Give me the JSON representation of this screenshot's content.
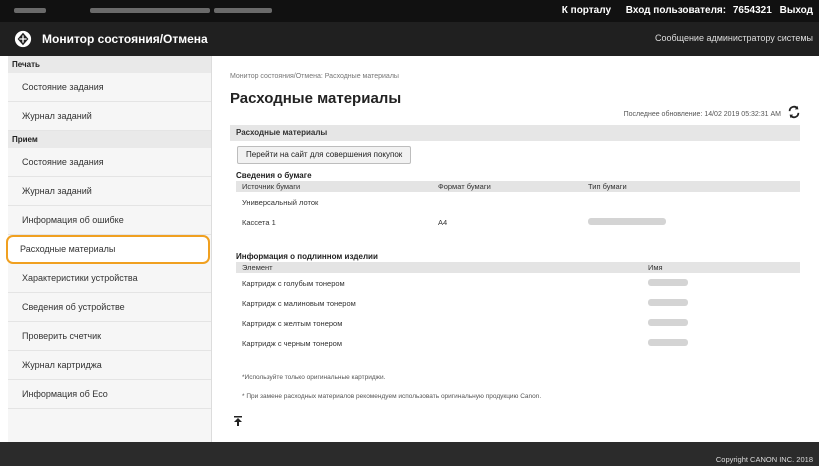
{
  "header": {
    "portal_link": "К порталу",
    "login_label": "Вход пользователя:",
    "login_user": "7654321",
    "logout_label": "Выход"
  },
  "titlebar": {
    "app_title": "Монитор состояния/Отмена",
    "admin_message": "Сообщение администратору системы"
  },
  "sidebar": {
    "print_header": "Печать",
    "print_items": [
      {
        "label": "Состояние задания"
      },
      {
        "label": "Журнал заданий"
      }
    ],
    "receive_header": "Прием",
    "receive_items": [
      {
        "label": "Состояние задания"
      },
      {
        "label": "Журнал заданий"
      },
      {
        "label": "Информация об ошибке"
      },
      {
        "label": "Расходные материалы"
      },
      {
        "label": "Характеристики устройства"
      },
      {
        "label": "Сведения об устройстве"
      },
      {
        "label": "Проверить счетчик"
      },
      {
        "label": "Журнал картриджа"
      },
      {
        "label": "Информация об Eco"
      }
    ]
  },
  "main": {
    "breadcrumb": "Монитор состояния/Отмена: Расходные материалы",
    "title": "Расходные материалы",
    "last_update_label": "Последнее обновление:",
    "last_update_value": "14/02 2019 05:32:31 AM",
    "panel_header": "Расходные материалы",
    "buy_button": "Перейти на сайт для совершения покупок",
    "paper": {
      "title": "Сведения о бумаге",
      "headers": [
        "Источник бумаги",
        "Формат бумаги",
        "Тип бумаги"
      ],
      "rows": [
        {
          "source": "Универсальный лоток",
          "size": "",
          "type": ""
        },
        {
          "source": "Кассета 1",
          "size": "A4",
          "type": ""
        }
      ]
    },
    "parts": {
      "title": "Информация о подлинном изделии",
      "headers": [
        "Элемент",
        "Имя"
      ],
      "rows": [
        {
          "item": "Картридж с голубым тонером"
        },
        {
          "item": "Картридж с малиновым тонером"
        },
        {
          "item": "Картридж с желтым тонером"
        },
        {
          "item": "Картридж с черным тонером"
        }
      ]
    },
    "note1": "*Используйте только оригинальные картриджи.",
    "note2": "* При замене расходных материалов рекомендуем использовать оригинальную продукцию Canon."
  },
  "footer": {
    "copyright": "Copyright CANON INC. 2018"
  },
  "colors": {
    "topbar": "#111111",
    "titlebar": "#202020",
    "active_outline": "#f0a020",
    "panel_header": "#e6e6e6"
  }
}
